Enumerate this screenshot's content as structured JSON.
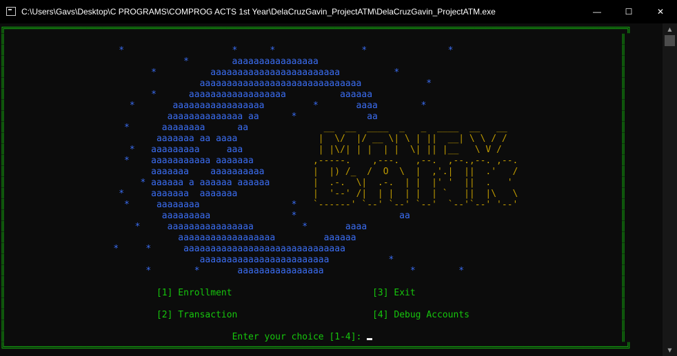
{
  "window": {
    "title": "C:\\Users\\Gavs\\Desktop\\C PROGRAMS\\COMPROG ACTS 1st Year\\DelaCruzGavin_ProjectATM\\DelaCruzGavin_ProjectATM.exe",
    "icon": "console-app-icon",
    "min_glyph": "—",
    "max_glyph": "☐",
    "close_glyph": "✕"
  },
  "console": {
    "border_top": "╔═══════════════════════════════════════════════════════════════════════════════════════════════════════════════════╗",
    "border_bottom": "╚═══════════════════════════════════════════════════════════════════════════════════════════════════════════════════╝",
    "border_side": "║",
    "art_lines": [
      "                     *                    *      *                *               *",
      "                                 *        aaaaaaaaaaaaaaaa",
      "                           *          aaaaaaaaaaaaaaaaaaaaaaaa          *",
      "                                    aaaaaaaaaaaaaaaaaaaaaaaaaaaaaa            *",
      "                           *      aaaaaaaaaaaaaaaaaa          aaaaaa",
      "                       *       aaaaaaaaaaaaaaaaa         *       aaaa        *",
      "                              aaaaaaaaaaaaaa aa      *             aa",
      "                      *      aaaaaaaa      aa",
      "                            aaaaaaa aa aaaa",
      "                       *   aaaaaaaaa     aaa",
      "                      *    aaaaaaaaaaa aaaaaaa",
      "                           aaaaaaa    aaaaaaaaaa",
      "                         * aaaaaa a aaaaaa aaaaaa",
      "                     *     aaaaaaa  aaaaaaa",
      "                      *     aaaaaaaa                 *",
      "                             aaaaaaaaa               *                   aa",
      "                        *     aaaaaaaaaaaaaaaa         *       aaaa",
      "                                aaaaaaaaaaaaaaaaaa         aaaaaa",
      "                    *     *      aaaaaaaaaaaaaaaaaaaaaaaaaaaaaa",
      "                                    aaaaaaaaaaaaaaaaaaaaaaaa           *",
      "                          *        *       aaaaaaaaaaaaaaaa                *        *"
    ],
    "logo_lines": [
      "",
      "",
      "",
      "",
      "",
      "",
      "",
      "                                                           __  __  ____  _   _  ____  __   __",
      "                                                          |  \\/  |/ __ \\| \\ | ||  __| \\ \\ / /",
      "                                                          | |\\/| | |  | |  \\| || |__   \\ V /",
      "                                                         ,-----.    ,---.   ,--.  ,--.,--. ,--.",
      "                                                         |  |) /_  /  O  \\  |  ,'.|  ||  .'   /",
      "                                                         |  .-.  \\|  .-.  | |  |' '  ||  .   '",
      "                                                         |  '--' /|  | |  | |  | `   ||  |\\   \\",
      "                                                         `------' `--' `--' `--'  `--'`--' '--'"
    ],
    "menu": {
      "enrollment": "[1] Enrollment",
      "exit": "[3] Exit",
      "transaction": "[2] Transaction",
      "debug": "[4] Debug Accounts"
    },
    "prompt": "Enter your choice [1-4]:"
  },
  "scrollbar": {
    "up_glyph": "▲",
    "down_glyph": "▼"
  }
}
